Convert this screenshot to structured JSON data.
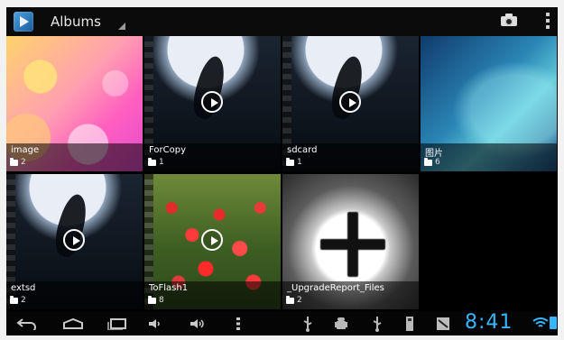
{
  "actionbar": {
    "title": "Albums"
  },
  "albums": [
    {
      "name": "image",
      "count": "2"
    },
    {
      "name": "ForCopy",
      "count": "1"
    },
    {
      "name": "sdcard",
      "count": "1"
    },
    {
      "name": "图片",
      "count": "6"
    },
    {
      "name": "extsd",
      "count": "2"
    },
    {
      "name": "ToFlash1",
      "count": "8"
    },
    {
      "name": "_UpgradeReport_Files",
      "count": "2"
    }
  ],
  "statusbar": {
    "time": "8:41"
  },
  "colors": {
    "clock": "#35b6ff",
    "battery": "#35b6ff"
  },
  "icons": {
    "app": "gallery-app-icon",
    "camera": "camera-icon",
    "overflow": "overflow-menu-icon",
    "play": "play-icon",
    "folder": "folder-icon",
    "back": "back-icon",
    "home": "home-icon",
    "recent": "recent-apps-icon",
    "volume_down": "volume-down-icon",
    "volume_up": "volume-up-icon",
    "menu": "menu-icon",
    "usb": "usb-icon",
    "android": "android-debug-icon",
    "sd": "sd-card-icon",
    "notification": "notification-icon",
    "wifi": "wifi-icon",
    "battery": "battery-icon"
  }
}
